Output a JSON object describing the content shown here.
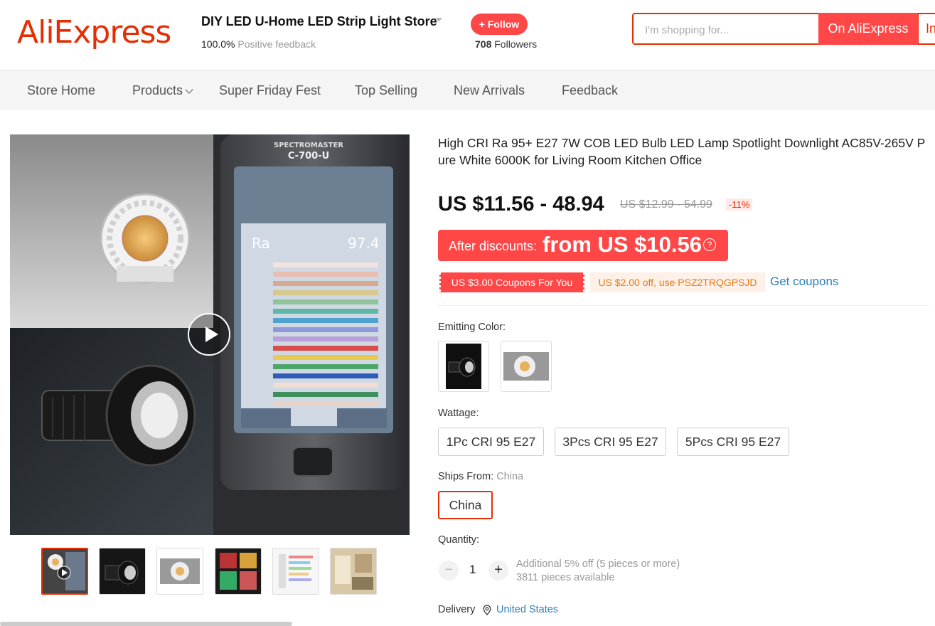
{
  "header": {
    "logo_text": "AliExpress",
    "store_name": "DIY LED U-Home LED Strip Light Store",
    "feedback_value": "100.0%",
    "feedback_label": "Positive feedback",
    "follow_label": "+ Follow",
    "followers_count": "708",
    "followers_label": "Followers",
    "search_placeholder": "I'm shopping for...",
    "search_button": "On AliExpress",
    "search_button2": "In"
  },
  "nav": {
    "items": [
      "Store Home",
      "Products",
      "Super Friday Fest",
      "Top Selling",
      "New Arrivals",
      "Feedback"
    ]
  },
  "gallery": {
    "meter_brand": "SPECTROMASTER",
    "meter_model": "C-700-U",
    "meter_metric": "Ra",
    "meter_value": "97.4"
  },
  "product": {
    "title": "High CRI Ra 95+ E27 7W COB LED Bulb LED Lamp Spotlight Downlight AC85V-265V Pure White 6000K for Living Room Kitchen Office",
    "price": "US $11.56 - 48.94",
    "original_price": "US $12.99 - 54.99",
    "discount": "-11%",
    "after_discount_label": "After discounts:",
    "after_discount_value": "from US $10.56",
    "coupon1": "US $3.00 Coupons For You",
    "coupon2": "US $2.00 off, use PSZ2TRQGPSJD",
    "get_coupons": "Get coupons",
    "emitting_color_label": "Emitting Color:",
    "wattage_label": "Wattage:",
    "wattage_options": [
      "1Pc CRI 95 E27",
      "3Pcs CRI 95 E27",
      "5Pcs CRI 95 E27"
    ],
    "ships_from_label": "Ships From:",
    "ships_from_value": "China",
    "ships_option": "China",
    "quantity_label": "Quantity:",
    "quantity_value": "1",
    "qty_minus": "−",
    "qty_plus": "+",
    "quantity_note1": "Additional 5% off (5 pieces or more)",
    "quantity_note2": "3811 pieces available",
    "delivery_label": "Delivery",
    "delivery_location": "United States"
  },
  "colors": {
    "accent": "#ff4747",
    "brand": "#e62e04",
    "link": "#2e7fb8"
  }
}
